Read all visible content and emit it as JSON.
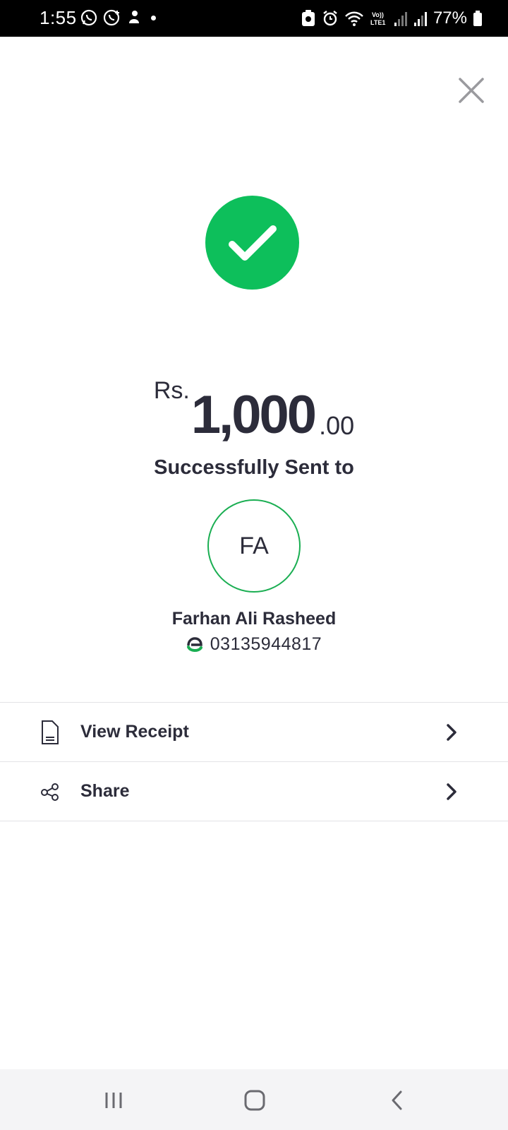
{
  "status_bar": {
    "time": "1:55",
    "battery": "77%",
    "icons": [
      "whatsapp-icon",
      "whatsapp-business-icon",
      "game-icon",
      "notification-dot",
      "clipboard-icon",
      "alarm-icon",
      "wifi-icon",
      "volte-icon",
      "signal-icon",
      "signal-icon",
      "battery-icon"
    ]
  },
  "close": {
    "icon": "close-icon"
  },
  "success": {
    "icon": "checkmark-icon",
    "color": "#0dbf5b"
  },
  "amount": {
    "currency": "Rs.",
    "major": "1,000",
    "minor": ".00"
  },
  "status_text": "Successfully Sent to",
  "recipient": {
    "initials": "FA",
    "name": "Farhan Ali Rasheed",
    "phone": "03135944817",
    "provider_icon": "easypaisa-logo-icon"
  },
  "actions": [
    {
      "label": "View Receipt",
      "icon": "receipt-icon"
    },
    {
      "label": "Share",
      "icon": "share-icon"
    }
  ],
  "nav": {
    "recents": "recents-icon",
    "home": "home-icon",
    "back": "back-icon"
  }
}
